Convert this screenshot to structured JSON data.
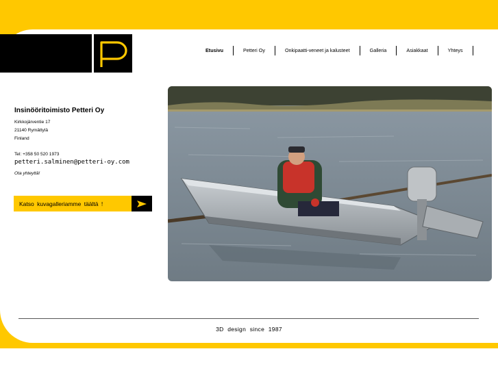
{
  "nav": {
    "items": [
      "Etusivu",
      "Petteri Oy",
      "Onkipaatti-veneet ja kalusteet",
      "Galleria",
      "Asiakkaat",
      "Yhteys"
    ]
  },
  "company": {
    "name": "Insinööritoimisto Petteri Oy",
    "street": "Kirkkojärventie 17",
    "postal": "21140 Rymättylä",
    "country": "Finland",
    "tel": "Tel: +358 50 520 1973",
    "email": "petteri.salminen@petteri-oy.com",
    "contact_link": "Ota yhteyttä!"
  },
  "gallery_button": {
    "label": "Katso kuvagalleriamme täältä !"
  },
  "footer": {
    "text": "3D design since 1987"
  },
  "colors": {
    "accent": "#ffc800",
    "logo_bg": "#000000"
  },
  "icons": {
    "logo": "letter-p-logo",
    "arrow": "arrow-right-icon"
  }
}
